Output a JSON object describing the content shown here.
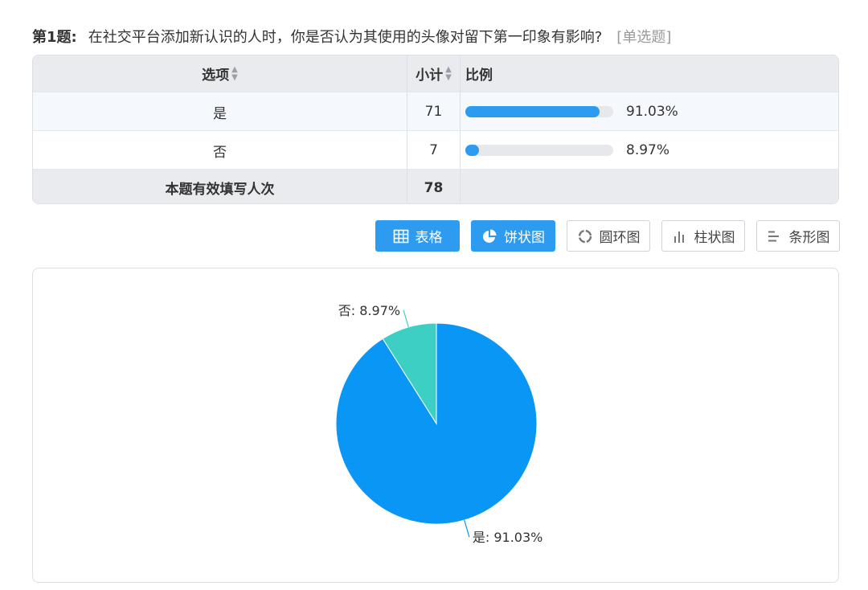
{
  "question": {
    "number": "第1题:",
    "text": "在社交平台添加新认识的人时，你是否认为其使用的头像对留下第一印象有影响?",
    "type": "[单选题]"
  },
  "table": {
    "headers": {
      "option": "选项",
      "count": "小计",
      "ratio": "比例"
    },
    "rows": [
      {
        "option": "是",
        "count": "71",
        "percent_label": "91.03%",
        "percent": 91.03
      },
      {
        "option": "否",
        "count": "7",
        "percent_label": "8.97%",
        "percent": 8.97
      }
    ],
    "total": {
      "label": "本题有效填写人次",
      "count": "78"
    }
  },
  "view_buttons": [
    {
      "label": "表格",
      "icon": "table-icon",
      "active": true
    },
    {
      "label": "饼状图",
      "icon": "pie-icon",
      "active": true
    },
    {
      "label": "圆环图",
      "icon": "ring-icon",
      "active": false
    },
    {
      "label": "柱状图",
      "icon": "column-chart-icon",
      "active": false
    },
    {
      "label": "条形图",
      "icon": "bar-chart-icon",
      "active": false
    }
  ],
  "colors": {
    "accent": "#2d9cf0",
    "pie_yes": "#0a96f5",
    "pie_no": "#3ecfc4"
  },
  "chart_data": {
    "type": "pie",
    "slices": [
      {
        "label": "是",
        "value": 91.03,
        "display": "是: 91.03%"
      },
      {
        "label": "否",
        "value": 8.97,
        "display": "否: 8.97%"
      }
    ]
  }
}
